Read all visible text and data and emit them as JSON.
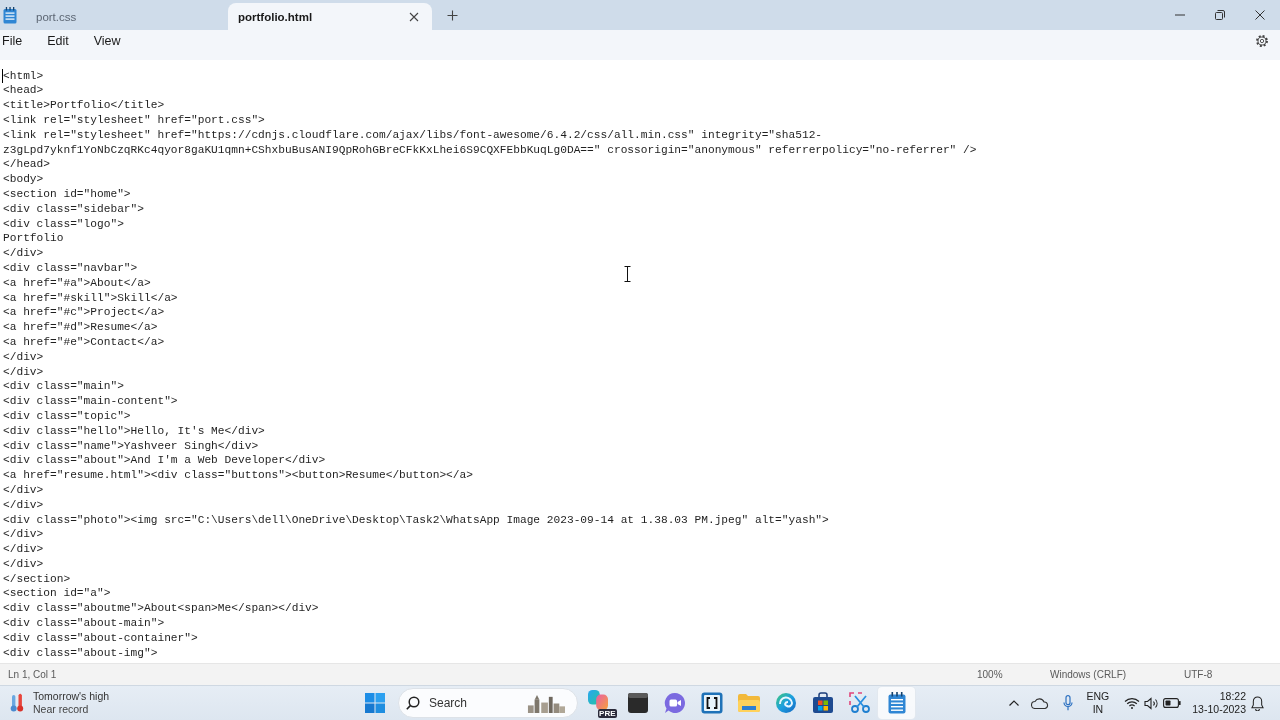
{
  "tabs": [
    {
      "label": "port.css",
      "selected": false
    },
    {
      "label": "portfolio.html",
      "selected": true
    }
  ],
  "menu": [
    "File",
    "Edit",
    "View"
  ],
  "editor": {
    "lines": [
      "<html>",
      "<head>",
      "<title>Portfolio</title>",
      "<link rel=\"stylesheet\" href=\"port.css\">",
      "<link rel=\"stylesheet\" href=\"https://cdnjs.cloudflare.com/ajax/libs/font-awesome/6.4.2/css/all.min.css\" integrity=\"sha512-",
      "z3gLpd7yknf1YoNbCzqRKc4qyor8gaKU1qmn+CShxbuBusANI9QpRohGBreCFkKxLhei6S9CQXFEbbKuqLg0DA==\" crossorigin=\"anonymous\" referrerpolicy=\"no-referrer\" />",
      "</head>",
      "<body>",
      "<section id=\"home\">",
      "<div class=\"sidebar\">",
      "<div class=\"logo\">",
      "Portfolio",
      "</div>",
      "<div class=\"navbar\">",
      "<a href=\"#a\">About</a>",
      "<a href=\"#skill\">Skill</a>",
      "<a href=\"#c\">Project</a>",
      "<a href=\"#d\">Resume</a>",
      "<a href=\"#e\">Contact</a>",
      "</div>",
      "</div>",
      "<div class=\"main\">",
      "<div class=\"main-content\">",
      "<div class=\"topic\">",
      "<div class=\"hello\">Hello, It's Me</div>",
      "<div class=\"name\">Yashveer Singh</div>",
      "<div class=\"about\">And I'm a Web Developer</div>",
      "<a href=\"resume.html\"><div class=\"buttons\"><button>Resume</button></a>",
      "</div>",
      "</div>",
      "<div class=\"photo\"><img src=\"C:\\Users\\dell\\OneDrive\\Desktop\\Task2\\WhatsApp Image 2023-09-14 at 1.38.03 PM.jpeg\" alt=\"yash\">",
      "</div>",
      "</div>",
      "</div>",
      "</section>",
      "<section id=\"a\">",
      "<div class=\"aboutme\">About<span>Me</span></div>",
      "<div class=\"about-main\">",
      "<div class=\"about-container\">",
      "<div class=\"about-img\">"
    ]
  },
  "status_bar": {
    "position": "Ln 1, Col 1",
    "zoom": "100%",
    "line_ending": "Windows (CRLF)",
    "encoding": "UTF-8"
  },
  "taskbar": {
    "weather": {
      "title": "Tomorrow's high",
      "subtitle": "Near record"
    },
    "search": {
      "label": "Search"
    },
    "apps": [
      {
        "kind": "assistant",
        "badge": "PRE",
        "selected": false
      },
      {
        "kind": "terminal",
        "selected": false
      },
      {
        "kind": "chat",
        "selected": false
      },
      {
        "kind": "brackets",
        "selected": false
      },
      {
        "kind": "folder",
        "selected": false
      },
      {
        "kind": "browser",
        "selected": false
      },
      {
        "kind": "store",
        "selected": false
      },
      {
        "kind": "snip",
        "selected": false
      },
      {
        "kind": "notepad",
        "selected": true
      }
    ],
    "language": {
      "top": "ENG",
      "bottom": "IN"
    },
    "clock": {
      "time": "18:22",
      "date": "13-10-2023"
    }
  }
}
